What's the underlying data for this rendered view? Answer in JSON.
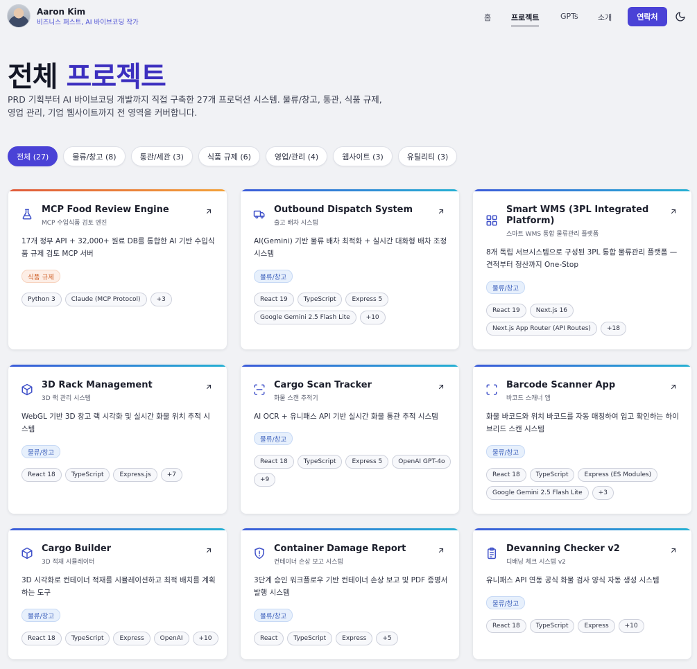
{
  "profile": {
    "name": "Aaron Kim",
    "subtitle": "비즈니스 퍼스트, AI 바이브코딩 작가"
  },
  "nav": {
    "home": "홈",
    "projects": "프로젝트",
    "gpts": "GPTs",
    "about": "소개",
    "contact": "연락처"
  },
  "hero": {
    "title_main": "전체",
    "title_accent": "프로젝트",
    "description": "PRD 기획부터 AI 바이브코딩 개발까지 직접 구축한 27개 프로덕션 시스템. 물류/창고, 통관, 식품 규제, 영업 관리, 기업 웹사이트까지 전 영역을 커버합니다."
  },
  "filters": [
    "전체 (27)",
    "물류/창고 (8)",
    "통관/세관 (3)",
    "식품 규제 (6)",
    "영업/관리 (4)",
    "웹사이트 (3)",
    "유틸리티 (3)"
  ],
  "colors": {
    "accent": "#4a42d6",
    "title_accent": "#3c2fbf",
    "category_blue": "#3f62bd",
    "category_orange": "#d0632c"
  },
  "cards": [
    {
      "title": "MCP Food Review Engine",
      "subtitle": "MCP 수입식품 검토 엔진",
      "icon": "flask-icon",
      "description": "17개 정부 API + 32,000+ 원료 DB를 통합한 AI 기반 수입식품 규제 검토 MCP 서버",
      "category": "식품 규제",
      "techs": [
        "Python 3",
        "Claude (MCP Protocol)",
        "+3"
      ]
    },
    {
      "title": "Outbound Dispatch System",
      "subtitle": "출고 배차 시스템",
      "icon": "truck-icon",
      "description": "AI(Gemini) 기반 물류 배차 최적화 + 실시간 대화형 배차 조정 시스템",
      "category": "물류/창고",
      "techs": [
        "React 19",
        "TypeScript",
        "Express 5",
        "Google Gemini 2.5 Flash Lite",
        "+10"
      ]
    },
    {
      "title": "Smart WMS (3PL Integrated Platform)",
      "subtitle": "스마트 WMS 통합 물류관리 플랫폼",
      "icon": "grid-icon",
      "description": "8개 독립 서브시스템으로 구성된 3PL 통합 물류관리 플랫폼 — 견적부터 정산까지 One-Stop",
      "category": "물류/창고",
      "techs": [
        "React 19",
        "Next.js 16",
        "Next.js App Router (API Routes)",
        "+18"
      ]
    },
    {
      "title": "3D Rack Management",
      "subtitle": "3D 랙 관리 시스템",
      "icon": "cube-icon",
      "description": "WebGL 기반 3D 창고 랙 시각화 및 실시간 화물 위치 추적 시스템",
      "category": "물류/창고",
      "techs": [
        "React 18",
        "TypeScript",
        "Express.js",
        "+7"
      ]
    },
    {
      "title": "Cargo Scan Tracker",
      "subtitle": "화물 스캔 추적기",
      "icon": "scan-icon",
      "description": "AI OCR + 유니패스 API 기반 실시간 화물 통관 추적 시스템",
      "category": "물류/창고",
      "techs": [
        "React 18",
        "TypeScript",
        "Express 5",
        "OpenAI GPT-4o",
        "+9"
      ]
    },
    {
      "title": "Barcode Scanner App",
      "subtitle": "바코드 스캐너 앱",
      "icon": "barcode-scan-icon",
      "description": "화물 바코드와 위치 바코드를 자동 매칭하여 입고 확인하는 하이브리드 스캔 시스템",
      "category": "물류/창고",
      "techs": [
        "React 18",
        "TypeScript",
        "Express (ES Modules)",
        "Google Gemini 2.5 Flash Lite",
        "+3"
      ]
    },
    {
      "title": "Cargo Builder",
      "subtitle": "3D 적재 시뮬레이터",
      "icon": "cube-icon",
      "description": "3D 시각화로 컨테이너 적재를 시뮬레이션하고 최적 배치를 계획하는 도구",
      "category": "물류/창고",
      "techs": [
        "React 18",
        "TypeScript",
        "Express",
        "OpenAI",
        "+10"
      ]
    },
    {
      "title": "Container Damage Report",
      "subtitle": "컨테이너 손상 보고 시스템",
      "icon": "shield-alert-icon",
      "description": "3단계 승인 워크플로우 기반 컨테이너 손상 보고 및 PDF 증명서 발행 시스템",
      "category": "물류/창고",
      "techs": [
        "React",
        "TypeScript",
        "Express",
        "+5"
      ]
    },
    {
      "title": "Devanning Checker v2",
      "subtitle": "디배닝 체크 시스템 v2",
      "icon": "clipboard-icon",
      "description": "유니패스 API 연동 공식 화물 검사 양식 자동 생성 시스템",
      "category": "물류/창고",
      "techs": [
        "React 18",
        "TypeScript",
        "Express",
        "+10"
      ]
    }
  ]
}
